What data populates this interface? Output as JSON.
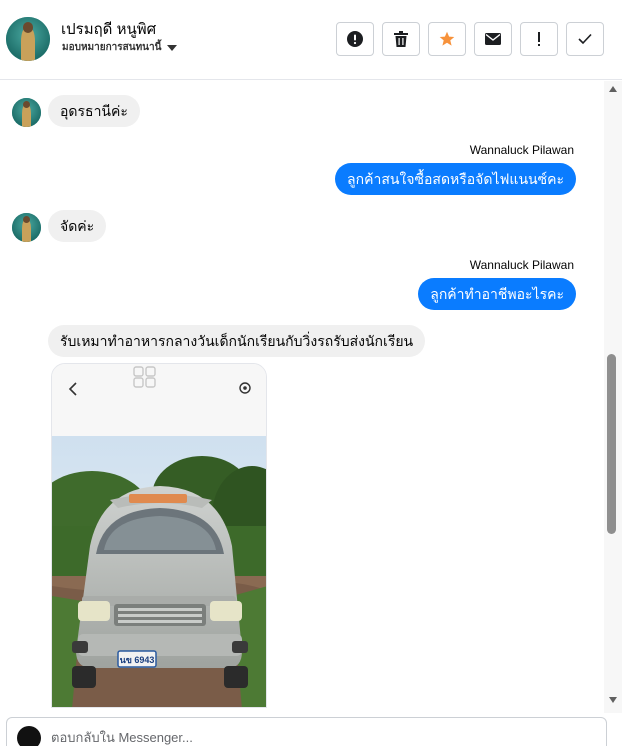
{
  "header": {
    "contact_name": "เปรมฤดี หนูพิศ",
    "contact_subtitle": "มอบหมายการสนทนานี้",
    "actions": [
      {
        "icon": "alert-icon",
        "name": "mark-spam-button"
      },
      {
        "icon": "trash-icon",
        "name": "delete-button"
      },
      {
        "icon": "star-icon",
        "name": "star-button"
      },
      {
        "icon": "mail-icon",
        "name": "mark-unread-button"
      },
      {
        "icon": "exclamation-icon",
        "name": "follow-up-button"
      },
      {
        "icon": "check-icon",
        "name": "mark-done-button"
      }
    ]
  },
  "messages": [
    {
      "direction": "in",
      "text": "อุดรธานีค่ะ"
    },
    {
      "direction": "out",
      "sender": "Wannaluck Pilawan",
      "text": "ลูกค้าสนใจซื้อสดหรือจัดไฟแนนซ์คะ"
    },
    {
      "direction": "in",
      "text": "จัดค่ะ"
    },
    {
      "direction": "out",
      "sender": "Wannaluck Pilawan",
      "text": "ลูกค้าทำอาชีพอะไรคะ"
    },
    {
      "direction": "in",
      "text": "รับเหมาทำอาหารกลางวันเด็กนักเรียนกับวิ่งรถรับส่งนักเรียน"
    }
  ],
  "attachment": {
    "plate_text": "นข 6943"
  },
  "composer": {
    "placeholder": "ตอบกลับใน Messenger..."
  },
  "colors": {
    "outgoing_bubble": "#0a7cff",
    "incoming_bubble": "#f0f0f0",
    "star": "#f7923b"
  }
}
